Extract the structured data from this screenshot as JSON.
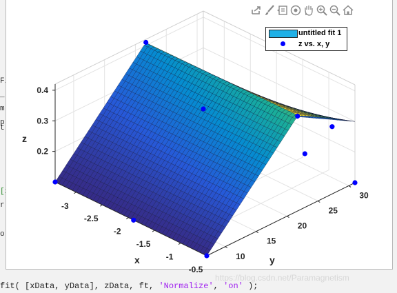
{
  "editor": {
    "fragments": [
      "Fi",
      "_",
      "m",
      "p",
      "[x",
      "r",
      "or",
      "t"
    ],
    "bottom_line": {
      "pre": "fit( [xData, yData], zData, ft, ",
      "str1": "'Normalize'",
      "sep": ", ",
      "str2": "'on'",
      "post": " );"
    }
  },
  "figure": {
    "toolbar": [
      {
        "name": "export-icon"
      },
      {
        "name": "brush-icon"
      },
      {
        "name": "data-tips-icon"
      },
      {
        "name": "rotate-3d-icon"
      },
      {
        "name": "pan-icon"
      },
      {
        "name": "zoom-in-icon"
      },
      {
        "name": "zoom-out-icon"
      },
      {
        "name": "home-icon"
      }
    ],
    "legend": {
      "entries": [
        {
          "label": "untitled fit 1",
          "color": "#1fb0e6"
        },
        {
          "label": "z vs. x, y",
          "color": "#0000ff"
        }
      ]
    }
  },
  "chart_data": {
    "type": "surface",
    "xlabel": "x",
    "ylabel": "y",
    "zlabel": "z",
    "x_ticks": [
      "-3",
      "-2.5",
      "-2",
      "-1.5",
      "-1",
      "-0.5"
    ],
    "y_ticks": [
      "10",
      "15",
      "20",
      "25",
      "30"
    ],
    "z_ticks": [
      "0.2",
      "0.3",
      "0.4"
    ],
    "xlim": [
      -3.4,
      -0.5
    ],
    "ylim": [
      7,
      31
    ],
    "zlim": [
      0.1,
      0.42
    ],
    "grid": true,
    "colormap": "parula",
    "legend_position": "top-right",
    "data_points": [
      {
        "x": -3.4,
        "y": 7,
        "z": 0.1
      },
      {
        "x": -0.5,
        "y": 7,
        "z": 0.1
      },
      {
        "x": -3.4,
        "y": 31,
        "z": 0.1
      },
      {
        "x": -0.5,
        "y": 31,
        "z": 0.1
      },
      {
        "x": -3.4,
        "y": 21.7,
        "z": 0.41
      },
      {
        "x": -0.5,
        "y": 21.7,
        "z": 0.41
      },
      {
        "x": -0.95,
        "y": 26.7,
        "z": 0.2
      },
      {
        "x": -0.5,
        "y": 27.3,
        "z": 0.32
      },
      {
        "x": -1.9,
        "y": 7,
        "z": 0.1
      }
    ]
  },
  "watermark": "https://blog.csdn.net/Paramagnetism"
}
